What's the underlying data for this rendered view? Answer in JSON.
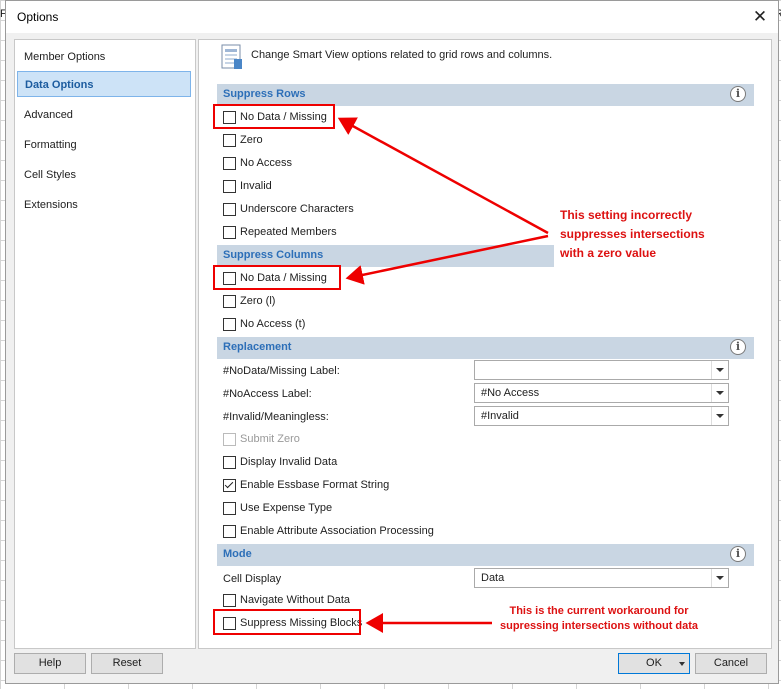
{
  "window": {
    "title": "Options",
    "close": "✕",
    "bg_letter": "F",
    "bg_letter_right": "R"
  },
  "sidebar": {
    "items": [
      {
        "label": "Member Options"
      },
      {
        "label": "Data Options"
      },
      {
        "label": "Advanced"
      },
      {
        "label": "Formatting"
      },
      {
        "label": "Cell Styles"
      },
      {
        "label": "Extensions"
      }
    ]
  },
  "header": {
    "text": "Change Smart View options related to grid rows and columns."
  },
  "suppress_rows": {
    "title": "Suppress Rows",
    "items": [
      {
        "label": "No Data / Missing",
        "checked": false
      },
      {
        "label": "Zero",
        "checked": false
      },
      {
        "label": "No Access",
        "checked": false
      },
      {
        "label": "Invalid",
        "checked": false
      },
      {
        "label": "Underscore Characters",
        "checked": false
      },
      {
        "label": "Repeated Members",
        "checked": false
      }
    ]
  },
  "suppress_columns": {
    "title": "Suppress Columns",
    "items": [
      {
        "label": "No Data / Missing",
        "checked": false
      },
      {
        "label": "Zero (l)",
        "checked": false
      },
      {
        "label": "No Access (t)",
        "checked": false
      }
    ]
  },
  "replacement": {
    "title": "Replacement",
    "fields": [
      {
        "label": "#NoData/Missing Label:",
        "value": ""
      },
      {
        "label": "#NoAccess Label:",
        "value": "#No Access"
      },
      {
        "label": "#Invalid/Meaningless:",
        "value": "#Invalid"
      }
    ],
    "items": [
      {
        "label": "Submit Zero",
        "checked": false,
        "disabled": true
      },
      {
        "label": "Display Invalid Data",
        "checked": false
      },
      {
        "label": "Enable Essbase Format String",
        "checked": true
      },
      {
        "label": "Use Expense Type",
        "checked": false
      },
      {
        "label": "Enable Attribute Association Processing",
        "checked": false
      }
    ]
  },
  "mode": {
    "title": "Mode",
    "cell_display_label": "Cell Display",
    "cell_display_value": "Data",
    "items": [
      {
        "label": "Navigate Without Data",
        "checked": false
      },
      {
        "label": "Suppress Missing Blocks",
        "checked": false
      }
    ]
  },
  "info_glyph": "i",
  "buttons": {
    "help": "Help",
    "reset": "Reset",
    "ok": "OK",
    "cancel": "Cancel"
  },
  "annotations": {
    "top_lines": [
      "This setting incorrectly",
      "suppresses intersections",
      "with a zero value"
    ],
    "bottom_lines": [
      "This is the current workaround for",
      "supressing intersections without data"
    ],
    "color": "#dd1111"
  }
}
